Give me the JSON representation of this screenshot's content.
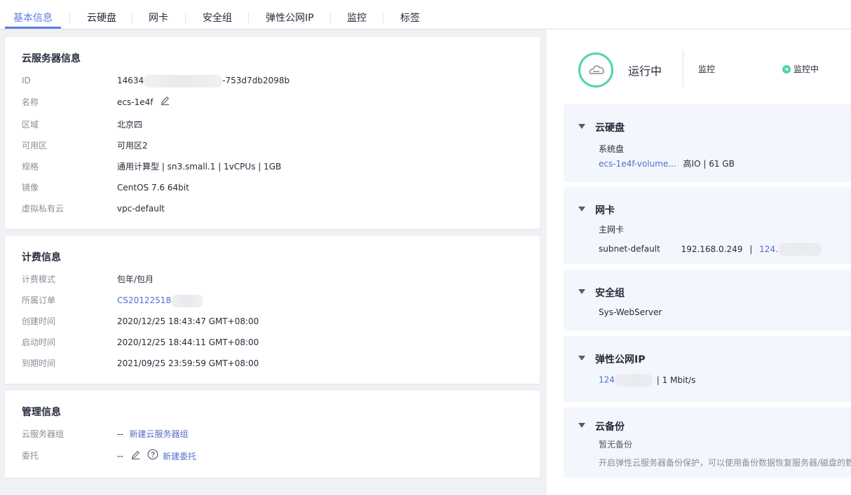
{
  "tabs": [
    "基本信息",
    "云硬盘",
    "网卡",
    "安全组",
    "弹性公网IP",
    "监控",
    "标签"
  ],
  "server_info": {
    "title": "云服务器信息",
    "id_label": "ID",
    "id_prefix": "14634",
    "id_suffix": "-753d7db2098b",
    "name_label": "名称",
    "name_value": "ecs-1e4f",
    "region_label": "区域",
    "region_value": "北京四",
    "az_label": "可用区",
    "az_value": "可用区2",
    "flavor_label": "规格",
    "flavor_value": "通用计算型 | sn3.small.1 | 1vCPUs | 1GB",
    "image_label": "镜像",
    "image_value": "CentOS 7.6 64bit",
    "vpc_label": "虚拟私有云",
    "vpc_value": "vpc-default"
  },
  "billing_info": {
    "title": "计费信息",
    "mode_label": "计费模式",
    "mode_value": "包年/包月",
    "order_label": "所属订单",
    "order_value": "CS20122518",
    "created_label": "创建时间",
    "created_value": "2020/12/25 18:43:47 GMT+08:00",
    "started_label": "启动时间",
    "started_value": "2020/12/25 18:44:11 GMT+08:00",
    "expire_label": "到期时间",
    "expire_value": "2021/09/25 23:59:59 GMT+08:00"
  },
  "management_info": {
    "title": "管理信息",
    "group_label": "云服务器组",
    "group_value": "--",
    "group_link": "新建云服务器组",
    "agency_label": "委托",
    "agency_value": "--",
    "agency_link": "新建委托"
  },
  "status": {
    "state": "运行中",
    "monitor_label": "监控",
    "monitor_value": "监控中",
    "accent": "#50d4ab"
  },
  "disk": {
    "title": "云硬盘",
    "system_label": "系统盘",
    "volume_name": "ecs-1e4f-volume...",
    "volume_detail": "高IO  |  61 GB"
  },
  "nic": {
    "title": "网卡",
    "primary_label": "主网卡",
    "subnet": "subnet-default",
    "private_ip": "192.168.0.249",
    "sep": "|",
    "public_ip_prefix": "124."
  },
  "security_group": {
    "title": "安全组",
    "name": "Sys-WebServer"
  },
  "eip": {
    "title": "弹性公网IP",
    "ip_prefix": "124",
    "bandwidth": "|  1 Mbit/s"
  },
  "backup": {
    "title": "云备份",
    "status": "暂无备份",
    "hint": "开启弹性云服务器备份保护，可以使用备份数据恢复服务器/磁盘的数"
  }
}
